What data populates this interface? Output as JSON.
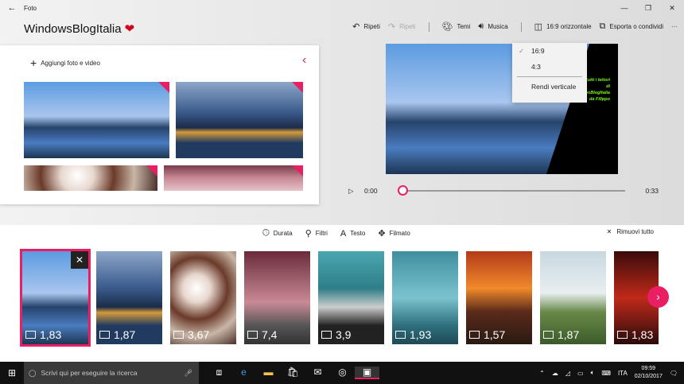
{
  "window": {
    "title": "Foto",
    "back": "←",
    "minimize": "—",
    "maximize": "❐",
    "close": "✕"
  },
  "brand": {
    "name": "WindowsBlogItalia",
    "heart": "❤"
  },
  "toolbar": {
    "undo": "Ripeti",
    "redo": "Ripeti",
    "themes": "Temi",
    "music": "Musica",
    "aspect": "16:9 orizzontale",
    "export": "Esporta o condividi",
    "more": "···"
  },
  "aspect_menu": {
    "items": [
      "16:9",
      "4:3"
    ],
    "selected": "16:9",
    "vertical": "Rendi verticale"
  },
  "library": {
    "add": "Aggiungi foto e video"
  },
  "player": {
    "overlay_lines": [
      "n tutti i lettori",
      "di",
      "wsBlogItalia",
      "da Filippo"
    ],
    "current": "0:00",
    "duration": "0:33",
    "progress": 0
  },
  "actions": {
    "duration": "Durata",
    "filters": "Filtri",
    "text": "Testo",
    "motion": "Filmato",
    "remove_all": "Rimuovi tutto"
  },
  "storyboard": [
    {
      "duration": "1,83",
      "selected": true
    },
    {
      "duration": "1,87"
    },
    {
      "duration": "3,67"
    },
    {
      "duration": "7,4"
    },
    {
      "duration": "3,9"
    },
    {
      "duration": "1,93"
    },
    {
      "duration": "1,57"
    },
    {
      "duration": "1,87"
    },
    {
      "duration": "1,83"
    }
  ],
  "taskbar": {
    "search_placeholder": "Scrivi qui per eseguire la ricerca",
    "language": "ITA",
    "time": "09:59",
    "date": "02/10/2017"
  },
  "colors": {
    "accent": "#e91e63"
  }
}
